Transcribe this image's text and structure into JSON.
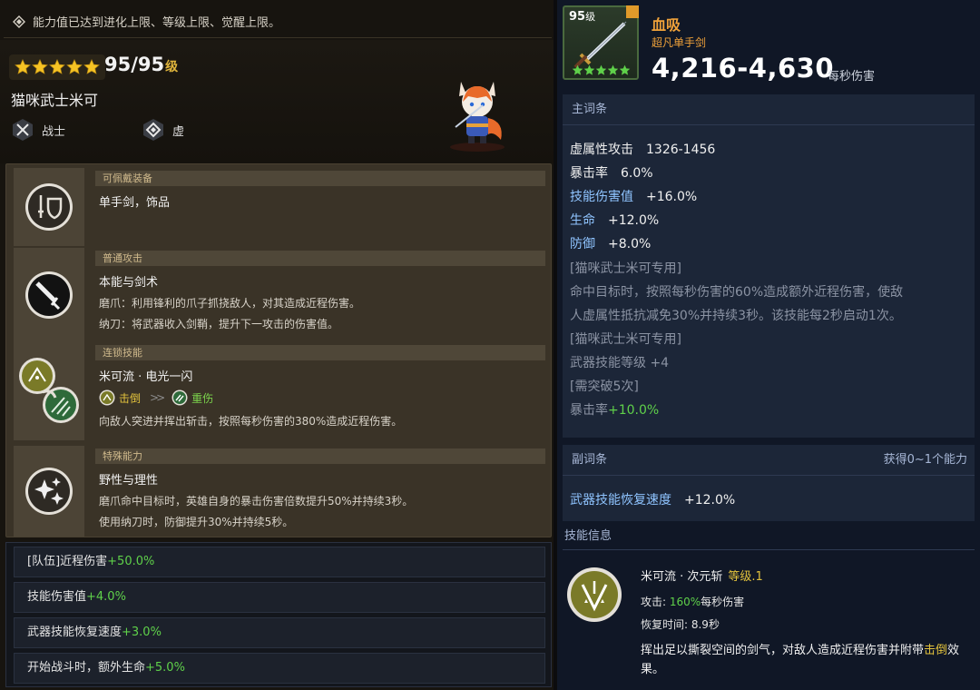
{
  "notice": {
    "text": "能力值已达到进化上限、等级上限、觉醒上限。",
    "icon": "diamond-icon"
  },
  "hero": {
    "stars": 5,
    "level": "95/95",
    "level_unit": "级",
    "name": "猫咪武士米可",
    "class_label": "战士",
    "element_label": "虚"
  },
  "abilities": {
    "equip": {
      "header": "可佩戴装备",
      "title": "单手剑，饰品"
    },
    "normal": {
      "header": "普通攻击",
      "title": "本能与剑术",
      "line1": "磨爪：利用锋利的爪子抓挠敌人，对其造成近程伤害。",
      "line2": "纳刀：将武器收入剑鞘，提升下一攻击的伤害值。"
    },
    "chain": {
      "header": "连锁技能",
      "title": "米可流 · 电光一闪",
      "from": "击倒",
      "arrow": ">>",
      "to": "重伤",
      "desc": "向敌人突进并挥出斩击，按照每秒伤害的380%造成近程伤害。"
    },
    "special": {
      "header": "特殊能力",
      "title": "野性与理性",
      "line1": "磨爪命中目标时，英雄自身的暴击伤害倍数提升50%并持续3秒。",
      "line2": "使用纳刀时，防御提升30%并持续5秒。"
    }
  },
  "buffs": [
    {
      "label": "[队伍]近程伤害",
      "value": "+50.0%"
    },
    {
      "label": "技能伤害值",
      "value": "+4.0%"
    },
    {
      "label": "武器技能恢复速度",
      "value": "+3.0%"
    },
    {
      "label": "开始战斗时，额外生命",
      "value": "+5.0%"
    }
  ],
  "weapon": {
    "level": "95",
    "level_unit": "级",
    "stars": 5,
    "name": "血吸",
    "type": "超凡单手剑",
    "damage": "4,216-4,630",
    "damage_unit": "每秒伤害"
  },
  "main_stats": {
    "header": "主词条",
    "lines": [
      {
        "k": "虚属性攻击",
        "v": "1326-1456"
      },
      {
        "k": "暴击率",
        "v": "6.0%"
      },
      {
        "k": "技能伤害值",
        "v": "+16.0%"
      },
      {
        "k": "生命",
        "v": "+12.0%"
      },
      {
        "k": "防御",
        "v": "+8.0%"
      }
    ],
    "exclusive1": "[猫咪武士米可专用]",
    "exclusive_desc1": "命中目标时，按照每秒伤害的60%造成额外近程伤害，使敌",
    "exclusive_desc2": "人虚属性抵抗减免30%并持续3秒。该技能每2秒启动1次。",
    "exclusive2": "[猫咪武士米可专用]",
    "skill_level": "武器技能等级  +4",
    "breakthrough": "[需突破5次]",
    "crit_label": "暴击率",
    "crit_value": "+10.0%"
  },
  "sub_stats": {
    "header": "副词条",
    "note": "获得0~1个能力",
    "k": "武器技能恢复速度",
    "v": "+12.0%"
  },
  "skill": {
    "header": "技能信息",
    "name": "米可流 · 次元斩",
    "level": "等级.1",
    "atk_label": "攻击: ",
    "atk_value": "160%",
    "atk_unit": "每秒伤害",
    "cooldown": "恢复时间:  8.9秒",
    "desc_a": "挥出足以撕裂空间的剑气，对敌人造成近程伤害并附带",
    "desc_kw": "击倒",
    "desc_b": "效果。"
  },
  "colors": {
    "accent_gold": "#e2c23c",
    "weapon_orange": "#f0a23a",
    "buff_green": "#5fd14a",
    "stat_blue": "#8fc4ff"
  }
}
